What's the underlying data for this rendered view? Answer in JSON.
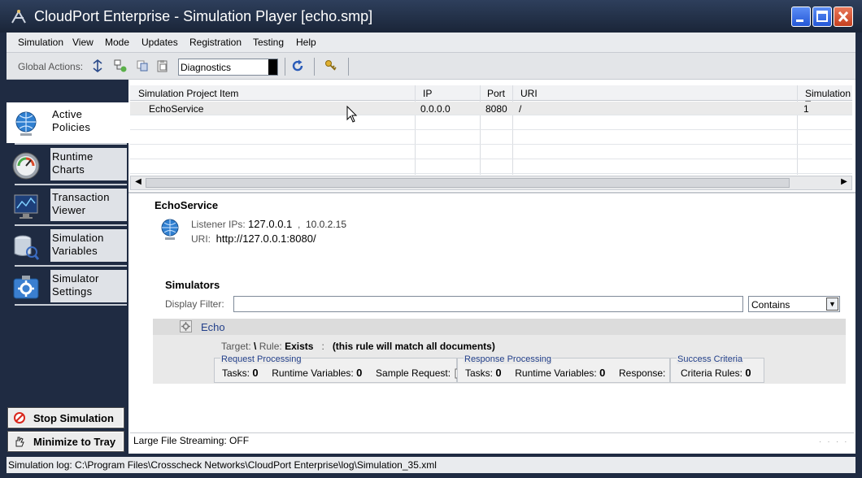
{
  "window": {
    "title": "CloudPort Enterprise - Simulation Player [echo.smp]"
  },
  "menu": [
    "Simulation",
    "View",
    "Mode",
    "Updates",
    "Registration",
    "Testing",
    "Help"
  ],
  "toolbar": {
    "global_actions_label": "Global Actions:",
    "diagnostics_value": "Diagnostics"
  },
  "nav": [
    {
      "label": "Active\nPolicies",
      "icon": "globe-icon",
      "active": true
    },
    {
      "label": "Runtime\nCharts",
      "icon": "gauge-icon",
      "active": false
    },
    {
      "label": "Transaction\nViewer",
      "icon": "monitor-icon",
      "active": false
    },
    {
      "label": "Simulation\nVariables",
      "icon": "database-icon",
      "active": false
    },
    {
      "label": "Simulator\nSettings",
      "icon": "settings-icon",
      "active": false
    }
  ],
  "left_buttons": {
    "stop": "Stop Simulation",
    "minimize": "Minimize to Tray"
  },
  "grid": {
    "columns": [
      "Simulation Project Item",
      "IP",
      "Port",
      "URI",
      "Simulation T"
    ],
    "rows": [
      {
        "item": "EchoService",
        "ip": "0.0.0.0",
        "port": "8080",
        "uri": "/",
        "sim": "1"
      }
    ]
  },
  "service": {
    "title": "EchoService",
    "listener_label": "Listener IPs:",
    "listener_ip1": "127.0.0.1",
    "listener_sep": ",",
    "listener_ip2": "10.0.2.15",
    "uri_label": "URI:",
    "uri": "http://127.0.0.1:8080/"
  },
  "simulators": {
    "title": "Simulators",
    "filter_label": "Display Filter:",
    "filter_value": "",
    "filter_mode": "Contains",
    "items": [
      {
        "name": "Echo",
        "target_label": "Target:",
        "target": "\\",
        "rule_label": "Rule:",
        "rule": "Exists",
        "rule_sep": ":",
        "rule_note": "(this rule will match all documents)",
        "request": {
          "title": "Request Processing",
          "tasks_label": "Tasks:",
          "tasks": "0",
          "vars_label": "Runtime Variables:",
          "vars": "0",
          "sample_label": "Sample Request:"
        },
        "response": {
          "title": "Response Processing",
          "tasks_label": "Tasks:",
          "tasks": "0",
          "vars_label": "Runtime Variables:",
          "vars": "0",
          "resp_label": "Response:"
        },
        "success": {
          "title": "Success Criteria",
          "rules_label": "Criteria Rules:",
          "rules": "0"
        }
      }
    ]
  },
  "status": {
    "streaming": "Large File Streaming: OFF"
  },
  "log": {
    "text": "Simulation log: C:\\Program Files\\Crosscheck Networks\\CloudPort Enterprise\\log\\Simulation_35.xml"
  }
}
